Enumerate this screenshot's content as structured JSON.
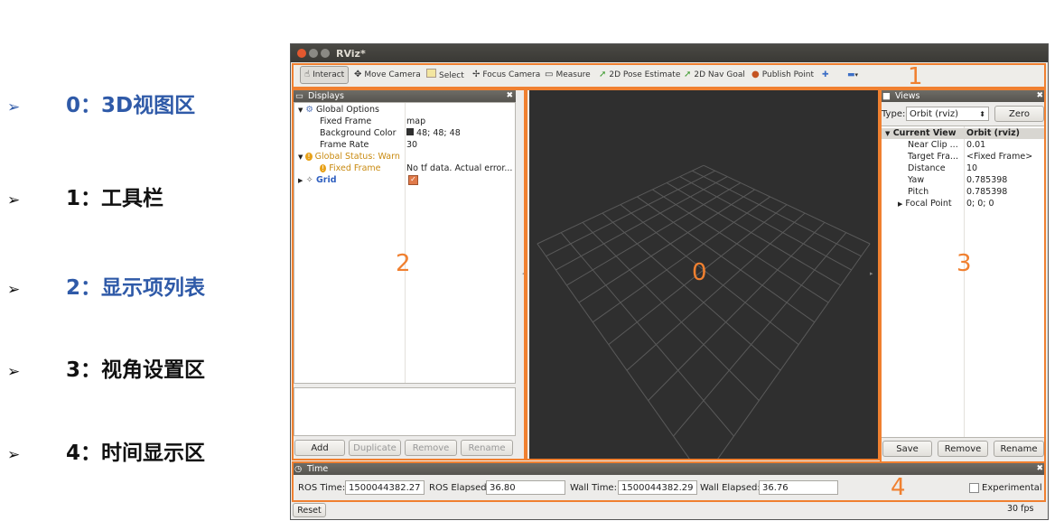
{
  "slide": {
    "items": [
      {
        "label": "0：3D视图区",
        "blue": true
      },
      {
        "label": "1：工具栏",
        "blue": false
      },
      {
        "label": "2：显示项列表",
        "blue": true
      },
      {
        "label": "3：视角设置区",
        "blue": false
      },
      {
        "label": "4：时间显示区",
        "blue": false
      }
    ],
    "arrow": "➢"
  },
  "window": {
    "title": "RViz*"
  },
  "toolbar": {
    "interact": "Interact",
    "move_camera": "Move Camera",
    "select": "Select",
    "focus_camera": "Focus Camera",
    "measure": "Measure",
    "pose_estimate": "2D Pose Estimate",
    "nav_goal": "2D Nav Goal",
    "publish_point": "Publish Point"
  },
  "displays": {
    "title": "Displays",
    "global_options": "Global Options",
    "fixed_frame_label": "Fixed Frame",
    "fixed_frame_value": "map",
    "bg_color_label": "Background Color",
    "bg_color_value": "48; 48; 48",
    "frame_rate_label": "Frame Rate",
    "frame_rate_value": "30",
    "global_status": "Global Status: Warn",
    "status_fixed_frame": "Fixed Frame",
    "status_fixed_frame_value": "No tf data.  Actual error...",
    "grid": "Grid",
    "add": "Add",
    "duplicate": "Duplicate",
    "remove": "Remove",
    "rename": "Rename"
  },
  "views": {
    "title": "Views",
    "type_label": "Type:",
    "type_value": "Orbit (rviz)",
    "zero": "Zero",
    "current_view": "Current View",
    "current_view_value": "Orbit (rviz)",
    "props": [
      {
        "k": "Near Clip ...",
        "v": "0.01"
      },
      {
        "k": "Target Fra...",
        "v": "<Fixed Frame>"
      },
      {
        "k": "Distance",
        "v": "10"
      },
      {
        "k": "Yaw",
        "v": "0.785398"
      },
      {
        "k": "Pitch",
        "v": "0.785398"
      },
      {
        "k": "Focal Point",
        "v": "0; 0; 0"
      }
    ],
    "save": "Save",
    "remove": "Remove",
    "rename": "Rename"
  },
  "time": {
    "title": "Time",
    "ros_time_label": "ROS Time:",
    "ros_time": "1500044382.27",
    "ros_elapsed_label": "ROS Elapsed:",
    "ros_elapsed": "36.80",
    "wall_time_label": "Wall Time:",
    "wall_time": "1500044382.29",
    "wall_elapsed_label": "Wall Elapsed:",
    "wall_elapsed": "36.76",
    "experimental": "Experimental",
    "reset": "Reset",
    "fps": "30 fps"
  },
  "overlay": {
    "n0": "0",
    "n1": "1",
    "n2": "2",
    "n3": "3",
    "n4": "4"
  },
  "colors": {
    "accent": "#f08030",
    "blue": "#2f5aa8",
    "view_bg": "#2f2f2f"
  }
}
